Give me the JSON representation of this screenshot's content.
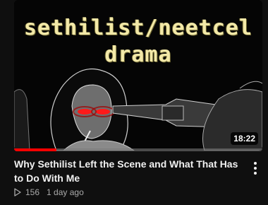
{
  "video": {
    "thumbnail_text_line1": "sethilist/neetcel",
    "thumbnail_text_line2": "drama",
    "duration": "18:22",
    "progress_fraction": 0.17,
    "title": "Why Sethilist Left the Scene and What That Has to Do With Me",
    "views": "156",
    "age": "1 day ago",
    "views_icon": "play-outline-icon",
    "menu_icon": "kebab-menu-icon"
  },
  "colors": {
    "background": "#0f0f0f",
    "progress": "#ff0000",
    "title_text": "#f1f1f1",
    "meta_text": "#aaaaaa",
    "thumb_text": "#f3e9a8"
  }
}
